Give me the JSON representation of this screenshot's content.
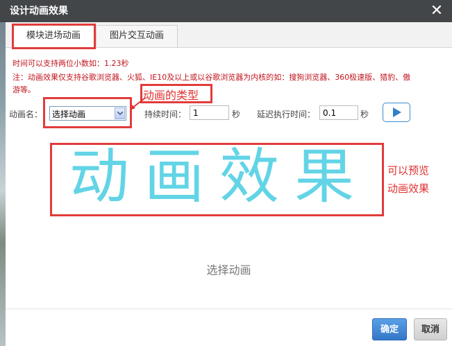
{
  "dialog": {
    "title": "设计动画效果",
    "close_icon": "close-icon"
  },
  "tabs": [
    {
      "label": "模块进场动画",
      "active": true
    },
    {
      "label": "图片交互动画",
      "active": false
    }
  ],
  "notes": {
    "line1": "时间可以支持两位小数如：1.23秒",
    "line2a": "注：动画效果仅支持谷歌浏览器、火狐、IE10及以上或以谷歌浏览器为内核的如：搜狗浏览器、360极速版、猎豹、傲",
    "line2b": "游等。"
  },
  "controls": {
    "animation_name_label": "动画名：",
    "animation_select_value": "选择动画",
    "duration_label": "持续时间：",
    "duration_value": "1",
    "duration_unit": "秒",
    "delay_label": "延迟执行时间：",
    "delay_value": "0.1",
    "delay_unit": "秒",
    "play_icon": "play-icon"
  },
  "annotations": {
    "type_note": "动画的类型",
    "preview_note_1": "可以预览",
    "preview_note_2": "动画效果"
  },
  "preview": {
    "big_text": "动画效果",
    "selected_name": "选择动画"
  },
  "footer": {
    "ok_label": "确定",
    "cancel_label": "取消"
  },
  "colors": {
    "title_bar": "#434649",
    "note_red": "#c0141c",
    "annotation_red": "#e03030",
    "preview_cyan": "#62d4e6",
    "ok_blue": "#3476c9"
  }
}
